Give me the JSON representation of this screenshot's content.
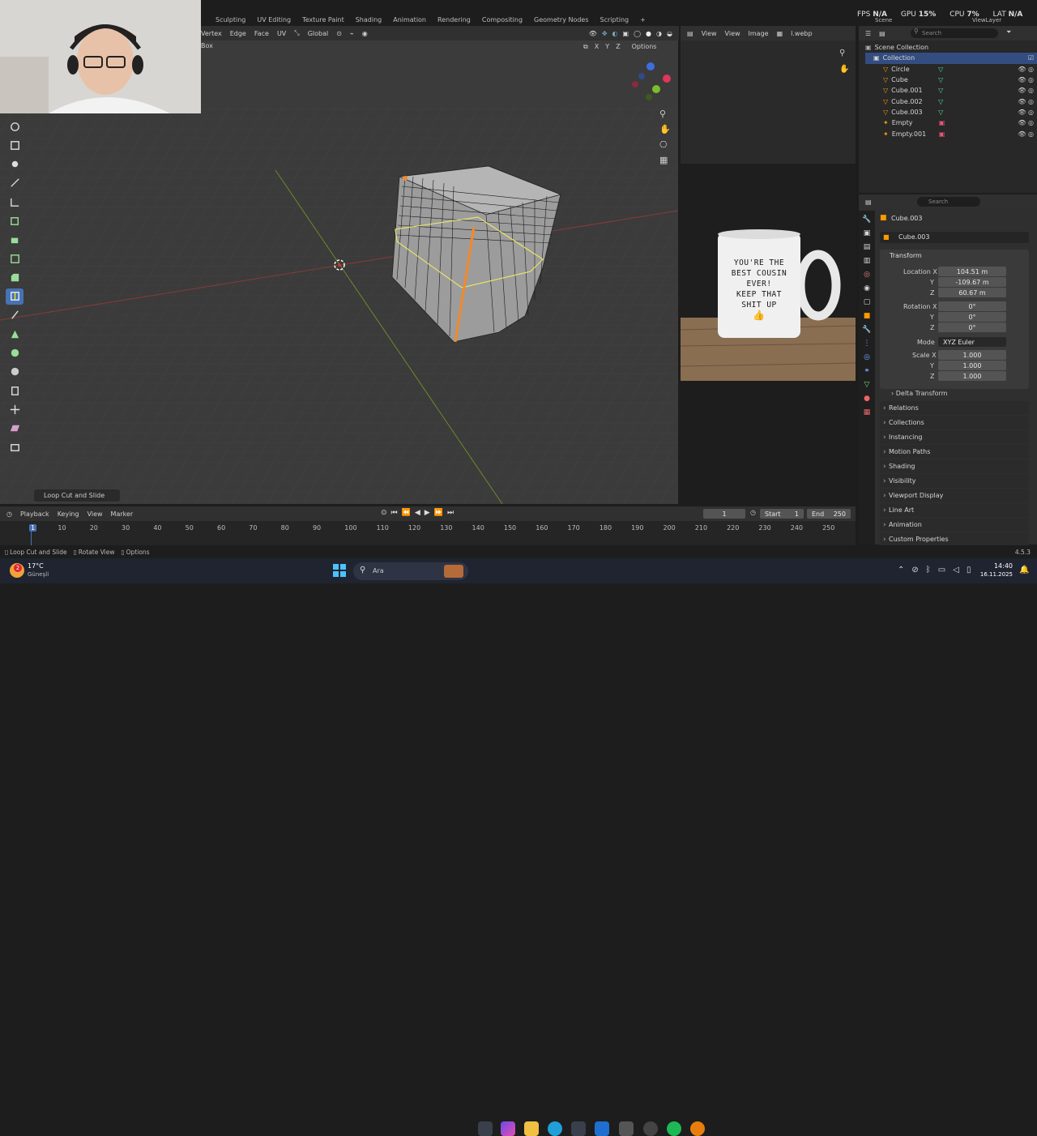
{
  "workspaces": [
    "Sculpting",
    "UV Editing",
    "Texture Paint",
    "Shading",
    "Animation",
    "Rendering",
    "Compositing",
    "Geometry Nodes",
    "Scripting",
    "+"
  ],
  "perf": {
    "fps_label": "FPS",
    "fps": "N/A",
    "gpu_label": "GPU",
    "gpu": "15%",
    "cpu_label": "CPU",
    "cpu": "7%",
    "lat_label": "LAT",
    "lat": "N/A"
  },
  "scene": {
    "scene": "Scene",
    "view_layer": "ViewLayer"
  },
  "viewport_header": {
    "menus": [
      "Vertex",
      "Edge",
      "Face",
      "UV"
    ],
    "orientation": "Global",
    "select_box": "Box",
    "axes": [
      "X",
      "Y",
      "Z"
    ],
    "options": "Options"
  },
  "image_editor": {
    "view": "View",
    "view2": "View",
    "image": "Image",
    "filename": "l.webp"
  },
  "mug": {
    "lines": [
      "YOU'RE THE",
      "BEST COUSIN",
      "EVER!",
      "KEEP THAT",
      "SHIT UP"
    ]
  },
  "outliner": {
    "search_placeholder": "Search",
    "scene_collection": "Scene Collection",
    "collection": "Collection",
    "items": [
      {
        "name": "Circle",
        "type": "mesh"
      },
      {
        "name": "Cube",
        "type": "mesh"
      },
      {
        "name": "Cube.001",
        "type": "mesh"
      },
      {
        "name": "Cube.002",
        "type": "mesh"
      },
      {
        "name": "Cube.003",
        "type": "mesh"
      },
      {
        "name": "Empty",
        "type": "empty"
      },
      {
        "name": "Empty.001",
        "type": "empty"
      }
    ]
  },
  "properties": {
    "search_placeholder": "Search",
    "object_name": "Cube.003",
    "datablock": "Cube.003",
    "transform": "Transform",
    "location_label": "Location X",
    "y": "Y",
    "z": "Z",
    "location": [
      "104.51 m",
      "-109.67 m",
      "60.67 m"
    ],
    "rotation_label": "Rotation X",
    "rotation": [
      "0°",
      "0°",
      "0°"
    ],
    "mode_label": "Mode",
    "mode": "XYZ Euler",
    "scale_label": "Scale X",
    "scale": [
      "1.000",
      "1.000",
      "1.000"
    ],
    "delta": "Delta Transform",
    "panels": [
      "Relations",
      "Collections",
      "Instancing",
      "Motion Paths",
      "Shading",
      "Visibility",
      "Viewport Display",
      "Line Art",
      "Animation",
      "Custom Properties"
    ]
  },
  "operator_panel": "Loop Cut and Slide",
  "timeline": {
    "menus": [
      "Playback",
      "Keying",
      "View",
      "Marker"
    ],
    "current": "1",
    "start_label": "Start",
    "start": "1",
    "end_label": "End",
    "end": "250",
    "ticks": [
      "1",
      "10",
      "20",
      "30",
      "40",
      "50",
      "60",
      "70",
      "80",
      "90",
      "100",
      "110",
      "120",
      "130",
      "140",
      "150",
      "160",
      "170",
      "180",
      "190",
      "200",
      "210",
      "220",
      "230",
      "240",
      "250"
    ]
  },
  "statusbar": {
    "left": "Loop Cut and Slide",
    "middle": "Rotate View",
    "right": "Options",
    "version": "4.5.3"
  },
  "taskbar": {
    "temp": "17°C",
    "weather": "Güneşli",
    "badge": "2",
    "search": "Ara",
    "time": "14:40",
    "date": "16.11.2025"
  }
}
